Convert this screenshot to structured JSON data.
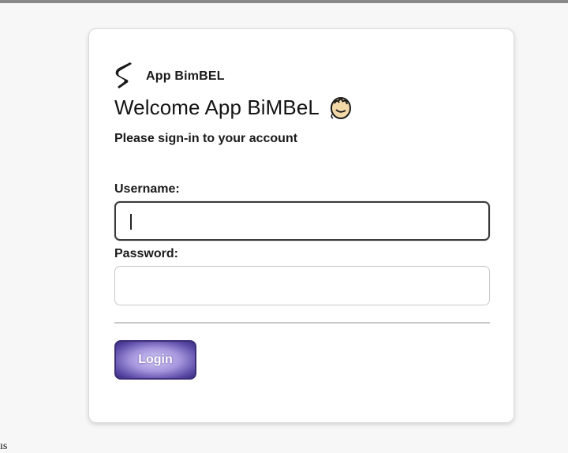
{
  "brand": {
    "name": "App BimBEL",
    "logo_icon": "brand-s-logo-icon"
  },
  "welcome": {
    "title": "Welcome App BiMBeL",
    "icon": "waving-hand-icon"
  },
  "subtitle": "Please sign-in to your account",
  "form": {
    "username_label": "Username:",
    "username_value": "",
    "password_label": "Password:",
    "password_value": "",
    "login_label": "Login"
  },
  "footer": {
    "corner_text": "ıs"
  },
  "colors": {
    "accent": "#3c2e78",
    "button_fill": "#a394dc",
    "focus_border": "#3a3a3a"
  }
}
